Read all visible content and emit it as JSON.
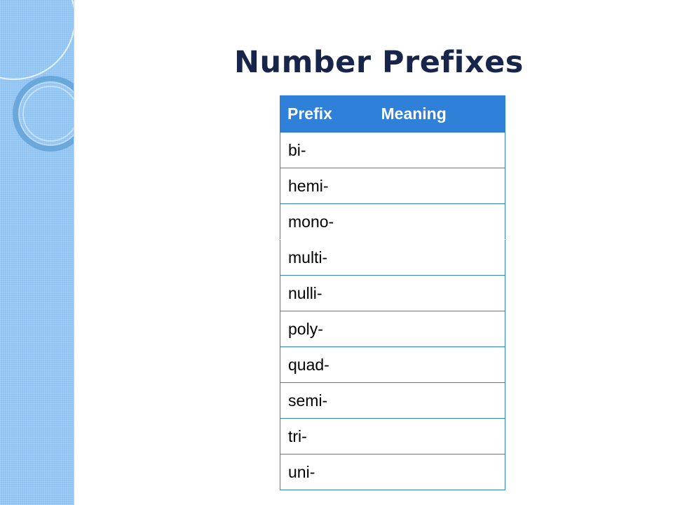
{
  "slide": {
    "title": "Number Prefixes",
    "accent_color": "#2f80d8",
    "title_color": "#17254a",
    "side_band_color": "#8fc3f2"
  },
  "table": {
    "headers": [
      "Prefix",
      "Meaning"
    ],
    "rows": [
      {
        "prefix": "bi-",
        "meaning": ""
      },
      {
        "prefix": "hemi-",
        "meaning": ""
      },
      {
        "prefix": "mono-",
        "meaning": ""
      },
      {
        "prefix": "multi-",
        "meaning": ""
      },
      {
        "prefix": "nulli-",
        "meaning": ""
      },
      {
        "prefix": "poly-",
        "meaning": ""
      },
      {
        "prefix": "quad-",
        "meaning": ""
      },
      {
        "prefix": "semi-",
        "meaning": ""
      },
      {
        "prefix": "tri-",
        "meaning": ""
      },
      {
        "prefix": "uni-",
        "meaning": ""
      }
    ]
  }
}
